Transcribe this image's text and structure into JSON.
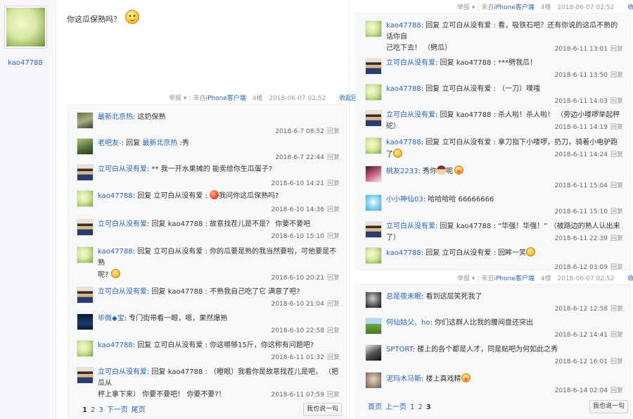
{
  "op": {
    "name": "kao47788"
  },
  "main_post": {
    "text": "你这瓜保熟吗？"
  },
  "tail_text": {
    "report": "举报",
    "report_arrow": "▾",
    "from": "来自",
    "client": "iPhone客户端",
    "fold_reply": "收起回复",
    "reply": "回复",
    "say_button": "我也说一句"
  },
  "left_thread": {
    "floor": "4楼",
    "time": "2018-06-07 02:52",
    "replies": [
      {
        "user": "最新北京热",
        "content": ": 这奶保熟",
        "time": "2018-6-7 08:52"
      },
      {
        "user": "老吧友-",
        "pre": ": 回复 ",
        "target": "最新北京热",
        "content": " :秀",
        "time": "2018-6-7 22:44"
      },
      {
        "user": "立可白从没有爱",
        "content": ": ** 我一开水果摊的 能卖给你生瓜蛋子?",
        "time": "2018-6-10 14:21"
      },
      {
        "user": "kao47788",
        "content": ": 回复 立可白从没有爱 :",
        "content2": "我问你这瓜保熟吗?",
        "time": "2018-6-10 14:36"
      },
      {
        "user": "立可白从没有爱",
        "content": ": 回复 kao47788 : 故意找茬儿是不是？ 你要不要吧",
        "time": "2018-6-10 15:10"
      },
      {
        "user": "kao47788",
        "content": ": 回复 立可白从没有爱 : 你的瓜要是熟的我当然要啦，可他要是不熟",
        "content2": "呢?",
        "time": "2018-6-10 20:21"
      },
      {
        "user": "立可白从没有爱",
        "content": ": 回复 kao47788 : 不熟我自己吃了它 满意了吧?",
        "time": "2018-6-10 21:04"
      },
      {
        "user": "毕微◆宝",
        "content": ": 专门街带看一眼，嗯，果然爆熟",
        "time": "2018-6-10 22:58"
      },
      {
        "user": "kao47788",
        "content": ": 回复 立可白从没有爱 : 你这哪够15斤，你这称有问题吧?",
        "time": "2018-6-11 01:32"
      },
      {
        "user": "立可白从没有爱",
        "content": ": 回复 kao47788 : （瞪眼）我看你是故意找茬儿是吧， （把瓜从",
        "content2": "秤上拿下来） 你要不要吧！ 你要不要?！",
        "time": "2018-6-11 07:59"
      }
    ],
    "pager": [
      "1",
      "2",
      "3",
      "下一页",
      "尾页"
    ]
  },
  "right_thread_top": {
    "floor": "4楼",
    "time": "2018-06-07 02:52",
    "replies": [
      {
        "user": "kao47788",
        "content": ": 回复 立可白从没有爱 : 看，吸铁石吧？还有你说的这瓜不熟的话你自",
        "content2": "己吃下去！ （劈瓜）",
        "time": "2018-6-11 13:01"
      },
      {
        "user": "立可白从没有爱",
        "content": ": 回复 kao47788 : ***劈我瓜！",
        "time": "2018-6-11 13:50"
      },
      {
        "user": "kao47788",
        "content": ": 回复 立可白从没有爱 : （一刀）噗嗤",
        "time": "2018-6-11 14:03"
      },
      {
        "user": "立可白从没有爱",
        "content": ": 回复 kao47788 : 杀人啦！杀人啦！ （旁边小喽啰举起秤砣）",
        "time": "2018-6-11 14:19"
      },
      {
        "user": "kao47788",
        "content": ": 回复 立可白从没有爱 : 拿刀指下小喽啰，扔刀，骑着小电驴跑了",
        "time": "2018-6-11 14:24"
      },
      {
        "user": "桃友2233",
        "content": ": 秀你",
        "content2": "呢",
        "time": "2018-6-11 15:04"
      },
      {
        "user": "小小神仙03",
        "content": ": 哈哈哈哈 66666666",
        "time": "2018-6-11 15:10"
      },
      {
        "user": "立可白从没有爱",
        "content": ": 回复 kao47788 : “华强！华强！” （被路边的熟人认出来了）",
        "time": "2018-6-11 22:39"
      },
      {
        "user": "kao47788",
        "content": ": 回复 立可白从没有爱 : 回眸一笑",
        "time": "2018-6-12 03:09"
      }
    ]
  },
  "right_thread_bottom": {
    "floor": "4楼",
    "time": "2018-06-07 02:52",
    "replies": [
      {
        "user": "总是夜未眠",
        "content": ": 看到这层笑死我了",
        "time": "2018-6-12 12:58"
      },
      {
        "user": "何仙姑父、ho",
        "content": ": 你们这群人比我的腰间盘还突出",
        "time": "2018-6-12 14:41"
      },
      {
        "user": "SPTORT",
        "content": ": 楼上的各个都是人才，同是贴吧为何如此之秀",
        "time": "2018-6-12 16:01"
      },
      {
        "user": "泥玛木马斯",
        "content": ": 楼上真戏精",
        "time": "2018-6-14 02:04"
      }
    ],
    "pager": [
      "首页",
      "上一页",
      "1",
      "2",
      "3"
    ]
  }
}
